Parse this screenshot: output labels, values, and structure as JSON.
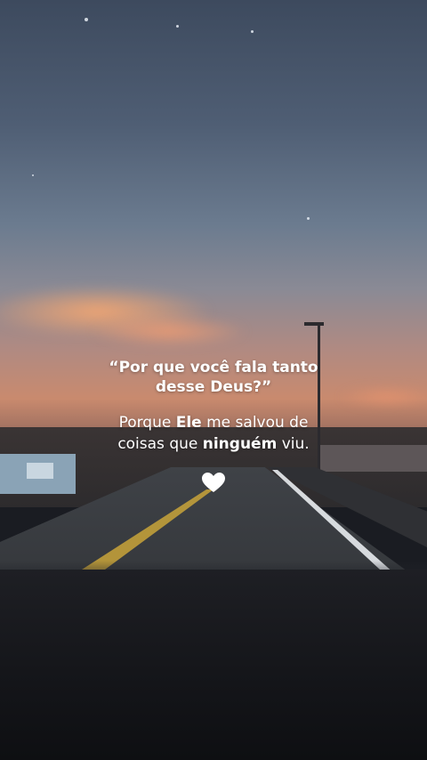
{
  "quote": {
    "line1": "“Por que você fala tanto",
    "line2": "desse Deus?”"
  },
  "answer": {
    "line1_pre": "Porque ",
    "line1_bold": "Ele",
    "line1_post": " me salvou de",
    "line2_pre": "coisas que ",
    "line2_bold": "ninguém",
    "line2_post": " viu."
  },
  "icons": {
    "heart": "heart-icon"
  },
  "colors": {
    "text": "#ffffff",
    "sunset": "#c98a6e"
  }
}
